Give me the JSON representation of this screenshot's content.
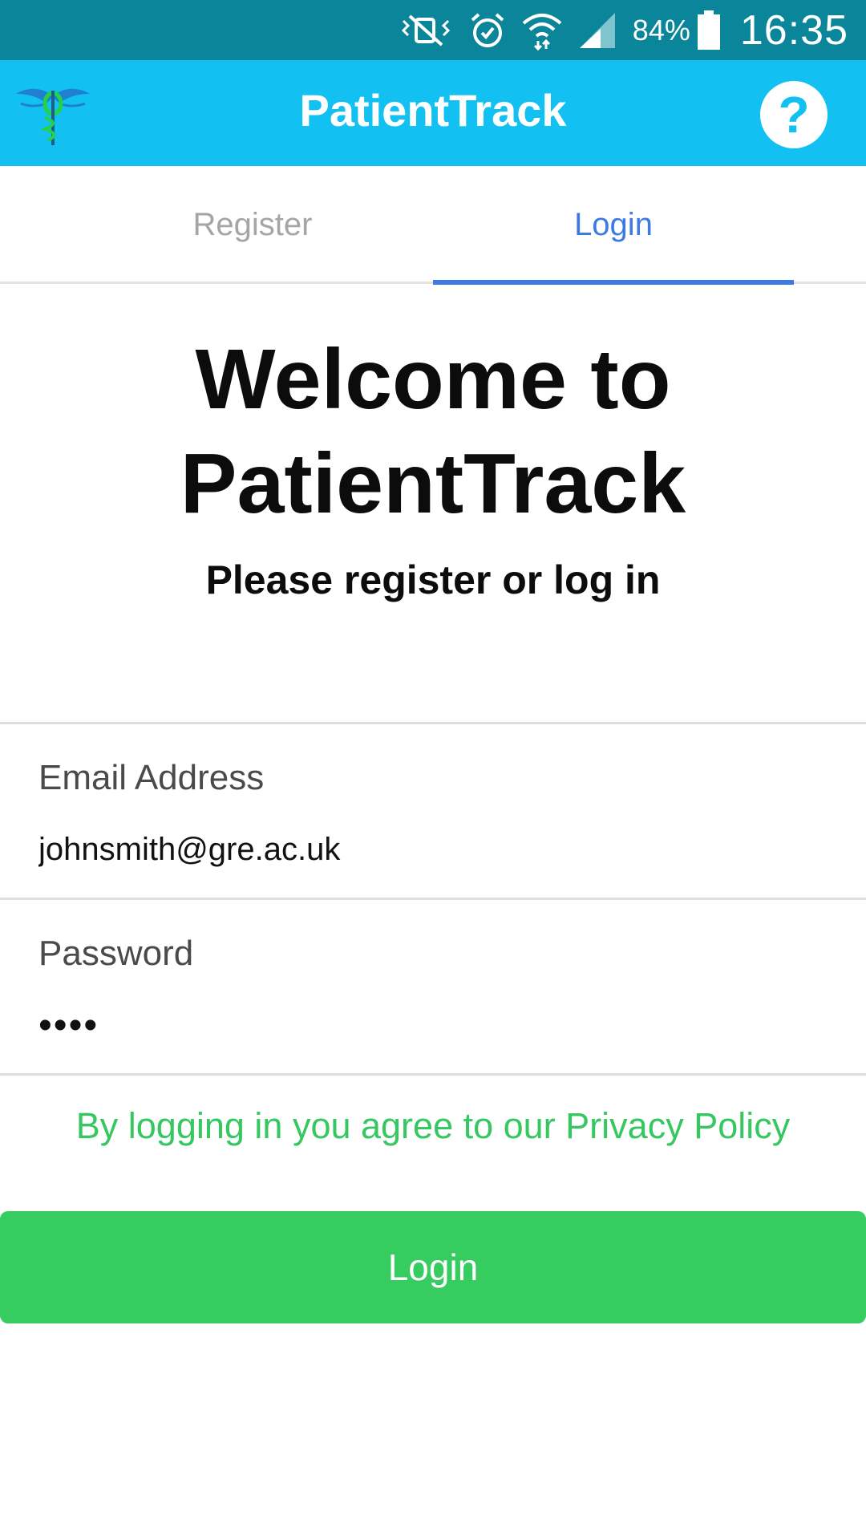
{
  "status_bar": {
    "battery_percent": "84%",
    "time": "16:35",
    "icons": [
      "vibrate-mute-icon",
      "alarm-icon",
      "wifi-icon",
      "signal-icon",
      "battery-icon"
    ]
  },
  "app_bar": {
    "title": "PatientTrack",
    "logo_icon": "caduceus-logo-icon",
    "help_icon": "help-icon",
    "help_glyph": "?"
  },
  "tabs": {
    "register_label": "Register",
    "login_label": "Login",
    "active": "Login"
  },
  "welcome": {
    "line1": "Welcome to",
    "line2": "PatientTrack",
    "subtitle": "Please register or log in"
  },
  "form": {
    "email": {
      "label": "Email Address",
      "value": "johnsmith@gre.ac.uk"
    },
    "password": {
      "label": "Password",
      "value": "••••"
    }
  },
  "privacy_text": "By logging in you agree to our Privacy Policy",
  "login_button_label": "Login",
  "colors": {
    "status_bar": "#0a8599",
    "app_bar": "#12c1f1",
    "tab_active": "#3d7ae6",
    "tab_inactive": "#a5a5a5",
    "accent_green": "#36cc5f"
  }
}
